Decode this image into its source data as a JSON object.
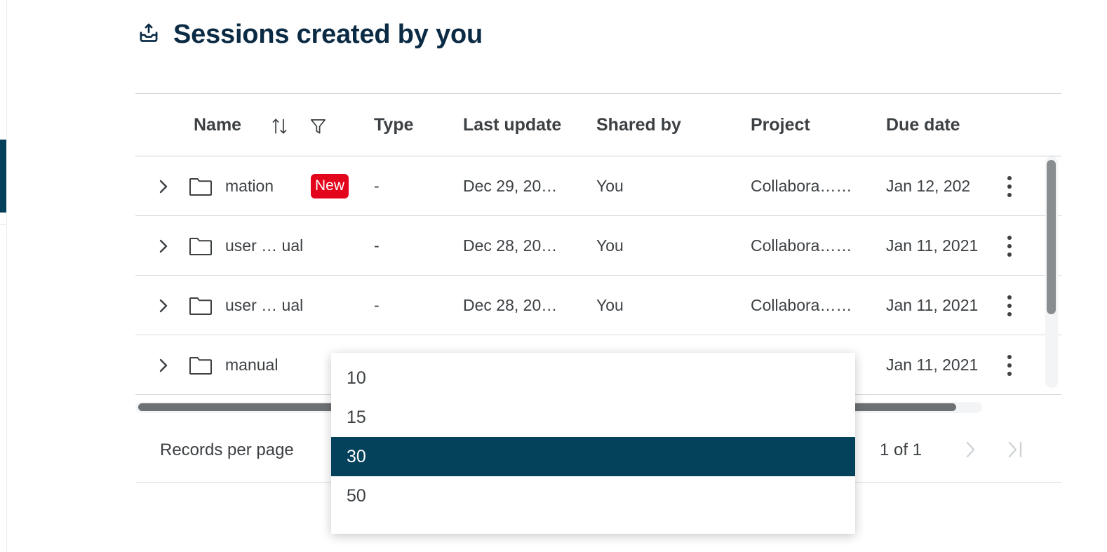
{
  "header": {
    "title": "Sessions created by you",
    "icon": "outbox-upload-icon"
  },
  "table": {
    "columns": [
      {
        "key": "name",
        "label": "Name"
      },
      {
        "key": "type",
        "label": "Type"
      },
      {
        "key": "update",
        "label": "Last update"
      },
      {
        "key": "shared",
        "label": "Shared by"
      },
      {
        "key": "project",
        "label": "Project"
      },
      {
        "key": "due",
        "label": "Due date"
      }
    ],
    "header_icons": {
      "sort": "sort-ascending-descending-icon",
      "filter": "filter-funnel-icon"
    },
    "rows": [
      {
        "name": "mation",
        "badge": "New",
        "type": "-",
        "update": "Dec 29, 20…",
        "shared": "You",
        "project": "Collabora……",
        "due": "Jan 12, 202"
      },
      {
        "name": "user … ual",
        "badge": "",
        "type": "-",
        "update": "Dec 28, 20…",
        "shared": "You",
        "project": "Collabora……",
        "due": "Jan 11, 2021"
      },
      {
        "name": "user … ual",
        "badge": "",
        "type": "-",
        "update": "Dec 28, 20…",
        "shared": "You",
        "project": "Collabora……",
        "due": "Jan 11, 2021"
      },
      {
        "name": "manual",
        "badge": "",
        "type": "",
        "update": "",
        "shared": "",
        "project": "",
        "due": "Jan 11, 2021"
      }
    ]
  },
  "footer": {
    "records_per_page_label": "Records per page",
    "page_indicator": "1 of 1",
    "next_page_icon": "chevron-right-icon",
    "last_page_icon": "chevron-last-page-icon"
  },
  "records_dropdown": {
    "open": true,
    "options": [
      "10",
      "15",
      "30",
      "50"
    ],
    "selected": "30"
  },
  "colors": {
    "title": "#0b2b45",
    "accent": "#04425c",
    "badge_new": "#e3051b",
    "text": "#3c4043",
    "rule": "#d7dbdf"
  }
}
